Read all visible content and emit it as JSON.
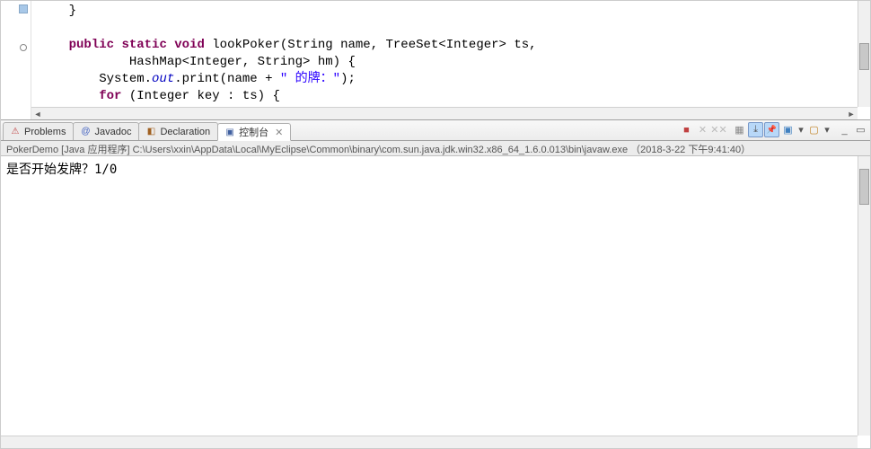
{
  "editor": {
    "line1": "    }",
    "line2": "",
    "line3_pre": "    ",
    "line3_kw1": "public",
    "line3_sp1": " ",
    "line3_kw2": "static",
    "line3_sp2": " ",
    "line3_kw3": "void",
    "line3_rest": " lookPoker(String name, TreeSet<Integer> ts,",
    "line4": "            HashMap<Integer, String> hm) {",
    "line5_pre": "        System.",
    "line5_out": "out",
    "line5_mid": ".print(name + ",
    "line5_str": "\" 的牌：\"",
    "line5_end": ");",
    "line6_pre": "        ",
    "line6_kw": "for",
    "line6_rest": " (Integer key : ts) {"
  },
  "tabs": {
    "problems": "Problems",
    "javadoc": "Javadoc",
    "declaration": "Declaration",
    "console": "控制台",
    "close_glyph": "✕"
  },
  "toolbar": {
    "terminate": "■",
    "remove": "✕",
    "remove_all": "✕✕",
    "clear": "▦",
    "scroll_lock": "⤓",
    "pin": "📌",
    "display": "▣",
    "new_console": "▢",
    "dropdown": "▾",
    "min": "_",
    "max": "▭"
  },
  "launch": {
    "text": "PokerDemo [Java 应用程序] C:\\Users\\xxin\\AppData\\Local\\MyEclipse\\Common\\binary\\com.sun.java.jdk.win32.x86_64_1.6.0.013\\bin\\javaw.exe （2018-3-22 下午9:41:40）"
  },
  "console": {
    "output": "是否开始发牌？1/0"
  }
}
